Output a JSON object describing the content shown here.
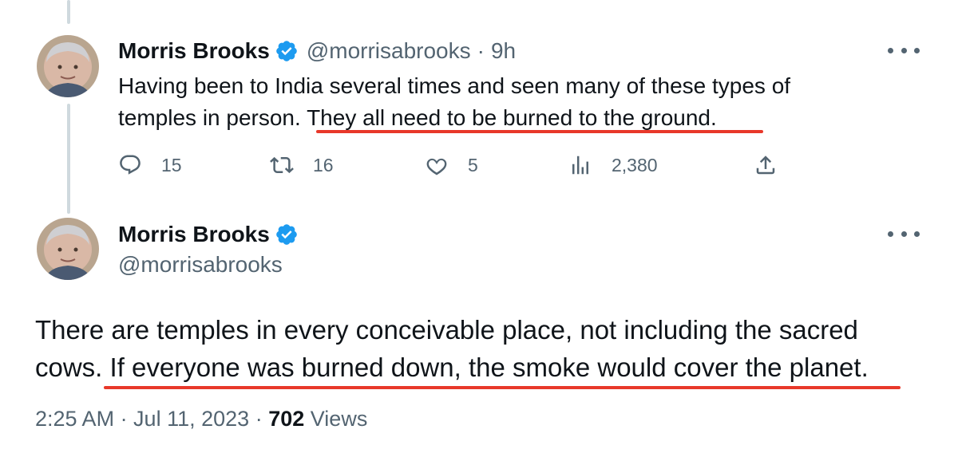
{
  "colors": {
    "accent": "#1d9bf0",
    "text_primary": "#0f1419",
    "text_secondary": "#536471",
    "annotation_underline": "#e8382a",
    "thread_line": "#cfd9de"
  },
  "reply_tweet": {
    "display_name": "Morris Brooks",
    "handle": "@morrisabrooks",
    "separator": "·",
    "time": "9h",
    "text_line1": "Having been to India several times and seen many of these types of",
    "text_line2_pre": "temples in person",
    "text_line2_post": ". They all need to be burned to the ground.",
    "more_icon": "more-horizontal-icon",
    "actions": {
      "replies": {
        "icon": "reply-icon",
        "count": "15"
      },
      "retweets": {
        "icon": "retweet-icon",
        "count": "16"
      },
      "likes": {
        "icon": "like-icon",
        "count": "5"
      },
      "views": {
        "icon": "views-icon",
        "count": "2,380"
      },
      "share": {
        "icon": "share-icon"
      }
    }
  },
  "main_tweet": {
    "display_name": "Morris Brooks",
    "handle": "@morrisabrooks",
    "text_line1": "There are temples in every conceivable place, not including the sacred",
    "text_line2": "cows. If everyone was burned down, the smoke would cover the planet.",
    "more_icon": "more-horizontal-icon",
    "timestamp": "2:25 AM · Jul 11, 2023",
    "separator": "·",
    "views_count": "702",
    "views_label": "Views"
  }
}
